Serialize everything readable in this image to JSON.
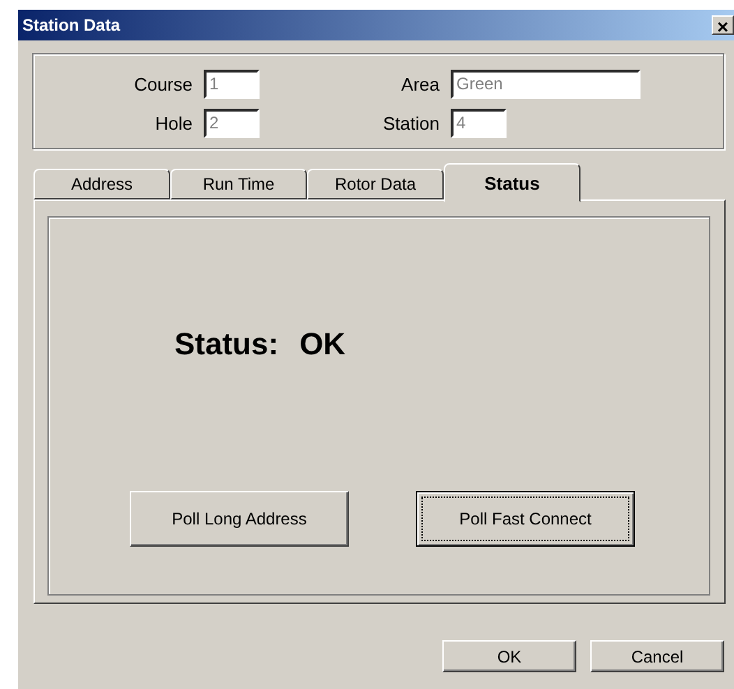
{
  "window": {
    "title": "Station Data",
    "close": "×"
  },
  "fields": [
    {
      "label": "Course",
      "value": "1",
      "kind": "narrow",
      "disabled": true
    },
    {
      "label": "Area",
      "value": "Green",
      "kind": "wide",
      "disabled": true
    },
    {
      "label": "Hole",
      "value": "2",
      "kind": "narrow",
      "disabled": true
    },
    {
      "label": "Station",
      "value": "4",
      "kind": "narrow",
      "disabled": true
    }
  ],
  "tabs": [
    {
      "label": "Address",
      "selected": false
    },
    {
      "label": "Run Time",
      "selected": false
    },
    {
      "label": "Rotor Data",
      "selected": false
    },
    {
      "label": "Status",
      "selected": true
    }
  ],
  "status": {
    "label": "Status:",
    "value": "OK"
  },
  "panel_buttons": [
    {
      "label": "Poll Long Address",
      "focused": false
    },
    {
      "label": "Poll Fast Connect",
      "focused": true
    }
  ],
  "buttons": [
    "OK",
    "Cancel"
  ]
}
